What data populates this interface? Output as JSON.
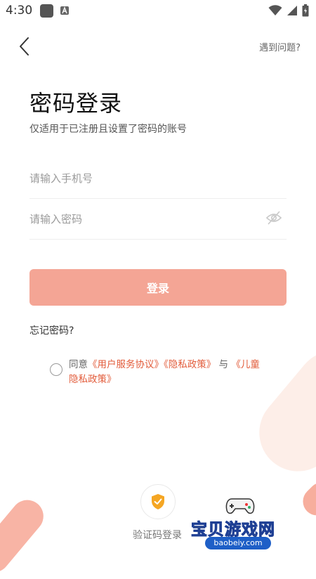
{
  "status_bar": {
    "time": "4:30",
    "icons": [
      "notification-square-icon",
      "app-a-icon",
      "wifi-icon",
      "signal-icon",
      "battery-icon"
    ]
  },
  "header": {
    "help_link": "遇到问题?"
  },
  "main": {
    "title": "密码登录",
    "subtitle": "仅适用于已注册且设置了密码的账号",
    "phone_placeholder": "请输入手机号",
    "password_placeholder": "请输入密码",
    "login_button": "登录",
    "forgot_password": "忘记密码?"
  },
  "agreement": {
    "prefix": "同意",
    "user_agreement": "《用户服务协议》",
    "privacy_policy": "《隐私政策》",
    "conjunction": "与",
    "children_policy": "《儿童隐私政策》"
  },
  "footer": {
    "code_login_label": "验证码登录"
  },
  "watermark": {
    "title": "宝贝游戏网",
    "url": "baobeiy.com"
  },
  "colors": {
    "accent": "#f4a595",
    "link": "#e25b3a",
    "shield": "#f5a623"
  }
}
